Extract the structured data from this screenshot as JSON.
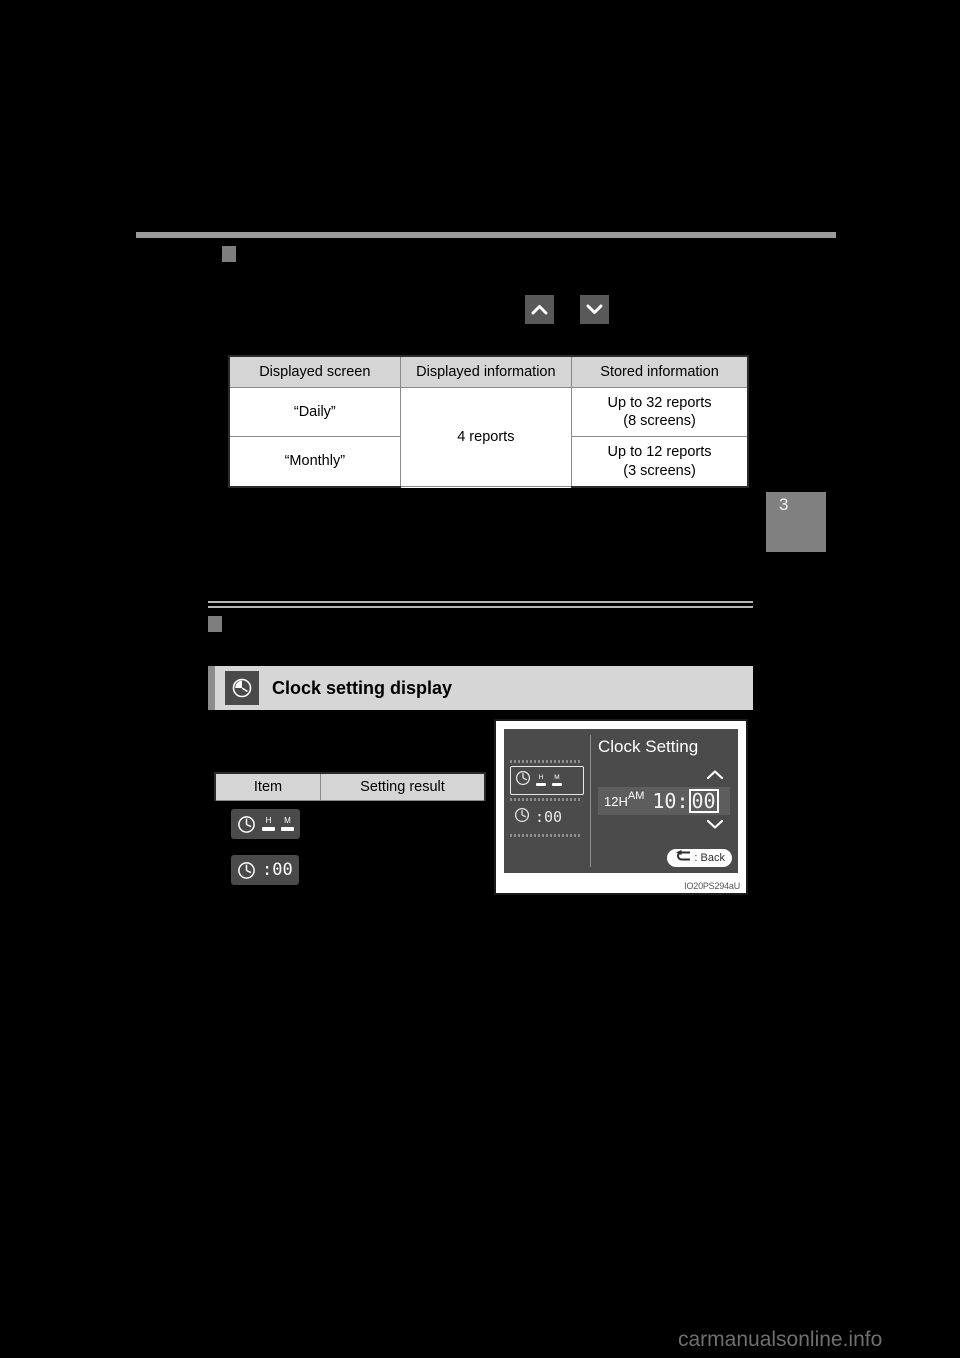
{
  "page": {
    "chapter_tab_number": "3",
    "watermark": "carmanualsonline.info"
  },
  "section_one": {
    "heading": "",
    "scroll_buttons": {
      "up_icon": "chevron-up-icon",
      "down_icon": "chevron-down-icon"
    },
    "table": {
      "headers": [
        "Displayed screen",
        "Displayed information",
        "Stored information"
      ],
      "rows": [
        {
          "displayed_screen": "“Daily”",
          "displayed_information": "4 reports",
          "stored_information_line1": "Up to 32 reports",
          "stored_information_line2": "(8 screens)"
        },
        {
          "displayed_screen": "“Monthly”",
          "displayed_information": "",
          "stored_information_line1": "Up to 12 reports",
          "stored_information_line2": "(3 screens)"
        }
      ]
    }
  },
  "section_two": {
    "heading": "",
    "title_band": {
      "icon": "clock-setting-icon",
      "label": "Clock setting display"
    },
    "item_table": {
      "headers": [
        "Item",
        "Setting result"
      ],
      "rows": [
        {
          "item_icon": "clock-hour-minute-icon",
          "item_icon_labels": [
            "H",
            "M"
          ],
          "setting_result": ""
        },
        {
          "item_icon": "clock-digits-icon",
          "item_icon_digits": ":00",
          "setting_result": ""
        }
      ]
    },
    "figure": {
      "caption": "IO20PS294aU",
      "screen": {
        "title": "Clock Setting",
        "left_rows": [
          {
            "icon": "clock-icon",
            "labels": [
              "H",
              "M"
            ],
            "selected": true
          },
          {
            "icon": "clock-icon",
            "digits": ":00",
            "selected": false
          }
        ],
        "format_label": "12H",
        "meridiem": "AM",
        "hours": "10",
        "separator": ":",
        "minutes": "00",
        "minutes_selected": true,
        "arrow_up_icon": "caret-up-icon",
        "arrow_down_icon": "caret-down-icon",
        "back_button": {
          "icon": "return-arrow-icon",
          "label": ": Back"
        }
      }
    }
  },
  "colors": {
    "page_background": "#000000",
    "rule": "#9a9a9a",
    "table_header": "#d5d5d5",
    "band_background": "#d6d6d6",
    "screen_background": "#4b4b4b",
    "chapter_tab": "#808080",
    "watermark": "#6f6f6f"
  }
}
